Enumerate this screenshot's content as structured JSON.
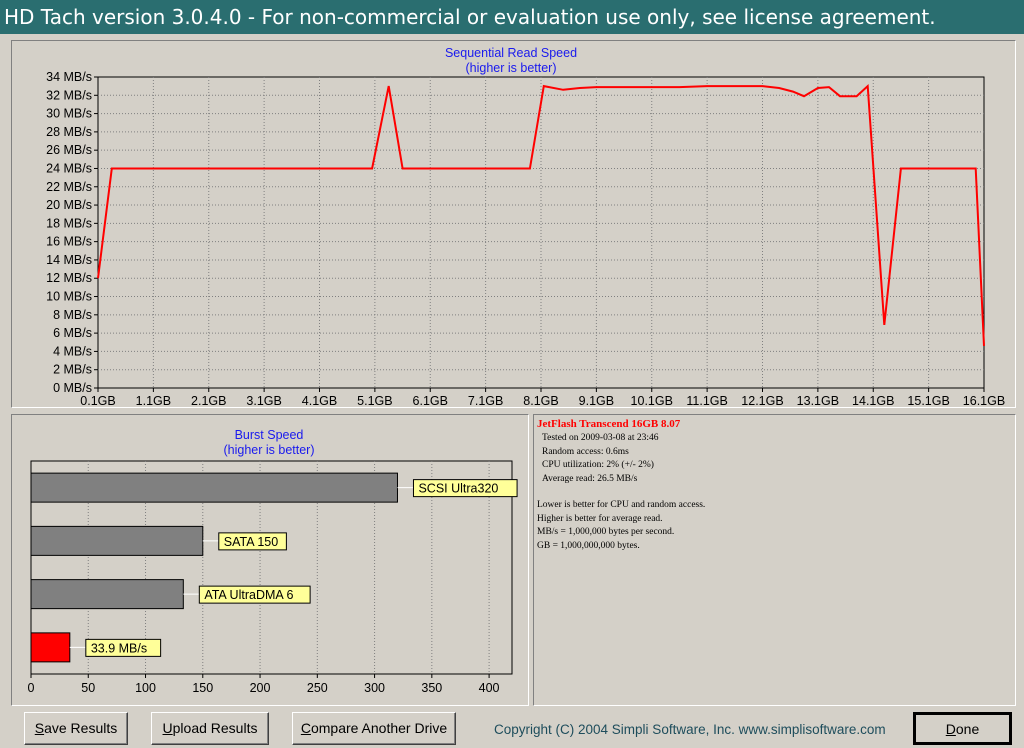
{
  "window": {
    "title": "HD Tach version 3.0.4.0   - For non-commercial or evaluation use only, see license agreement."
  },
  "sequential_chart": {
    "title": "Sequential Read Speed",
    "subtitle": "(higher is better)",
    "line_color": "#ff0000"
  },
  "burst_chart": {
    "title": "Burst Speed",
    "subtitle": "(higher is better)"
  },
  "chart_data": [
    {
      "type": "line",
      "title": "Sequential Read Speed",
      "subtitle": "(higher is better)",
      "y_unit_suffix": " MB/s",
      "ylim": [
        0,
        34
      ],
      "y_ticks": [
        0,
        2,
        4,
        6,
        8,
        10,
        12,
        14,
        16,
        18,
        20,
        22,
        24,
        26,
        28,
        30,
        32,
        34
      ],
      "xlim": [
        0.1,
        16.1
      ],
      "x_tick_labels": [
        "0.1GB",
        "1.1GB",
        "2.1GB",
        "3.1GB",
        "4.1GB",
        "5.1GB",
        "6.1GB",
        "7.1GB",
        "8.1GB",
        "9.1GB",
        "10.1GB",
        "11.1GB",
        "12.1GB",
        "13.1GB",
        "14.1GB",
        "15.1GB",
        "16.1GB"
      ],
      "x_tick_values": [
        0.1,
        1.1,
        2.1,
        3.1,
        4.1,
        5.1,
        6.1,
        7.1,
        8.1,
        9.1,
        10.1,
        11.1,
        12.1,
        13.1,
        14.1,
        15.1,
        16.1
      ],
      "grid": true,
      "series": [
        {
          "color": "#ff0000",
          "points": [
            [
              0.1,
              12
            ],
            [
              0.35,
              24
            ],
            [
              1.1,
              24
            ],
            [
              5.05,
              24
            ],
            [
              5.35,
              33
            ],
            [
              5.6,
              24
            ],
            [
              7.9,
              24
            ],
            [
              8.15,
              33
            ],
            [
              8.5,
              32.6
            ],
            [
              8.8,
              32.8
            ],
            [
              9.1,
              32.9
            ],
            [
              10.1,
              32.9
            ],
            [
              10.6,
              32.9
            ],
            [
              11.1,
              33
            ],
            [
              11.6,
              33
            ],
            [
              12.1,
              33
            ],
            [
              12.4,
              32.8
            ],
            [
              12.65,
              32.4
            ],
            [
              12.85,
              31.9
            ],
            [
              13.1,
              32.8
            ],
            [
              13.3,
              32.9
            ],
            [
              13.5,
              31.9
            ],
            [
              13.8,
              31.9
            ],
            [
              14.0,
              33
            ],
            [
              14.3,
              6.9
            ],
            [
              14.6,
              24
            ],
            [
              15.1,
              24
            ],
            [
              15.95,
              24
            ],
            [
              16.1,
              4.6
            ]
          ]
        }
      ]
    },
    {
      "type": "bar",
      "orientation": "horizontal",
      "title": "Burst Speed",
      "subtitle": "(higher is better)",
      "xlim": [
        0,
        420
      ],
      "x_ticks": [
        0,
        50,
        100,
        150,
        200,
        250,
        300,
        350,
        400
      ],
      "grid": true,
      "categories": [
        "SCSI Ultra320",
        "SATA 150",
        "ATA UltraDMA 6",
        "33.9 MB/s"
      ],
      "values": [
        320,
        150,
        133,
        33.9
      ],
      "colors": [
        "#808080",
        "#808080",
        "#808080",
        "#ff0000"
      ]
    }
  ],
  "info": {
    "drive_name": "JetFlash Transcend 16GB 8.07",
    "tested_on": "Tested on 2009-03-08 at 23:46",
    "random_access": "Random access: 0.6ms",
    "cpu_utilization": "CPU utilization: 2% (+/- 2%)",
    "average_read": "Average read: 26.5 MB/s",
    "note_lower": "Lower is better for CPU and random access.",
    "note_higher": "Higher is better for average read.",
    "note_mbs": "MB/s = 1,000,000 bytes per second.",
    "note_gb": "GB = 1,000,000,000 bytes."
  },
  "buttons": {
    "save": {
      "accel": "S",
      "rest": "ave Results"
    },
    "upload": {
      "accel": "U",
      "rest": "pload Results"
    },
    "compare": {
      "accel": "C",
      "rest": "ompare Another Drive"
    },
    "done": {
      "accel": "D",
      "rest": "one"
    }
  },
  "footer": {
    "copyright": "Copyright (C) 2004 Simpli Software, Inc. www.simplisoftware.com"
  }
}
